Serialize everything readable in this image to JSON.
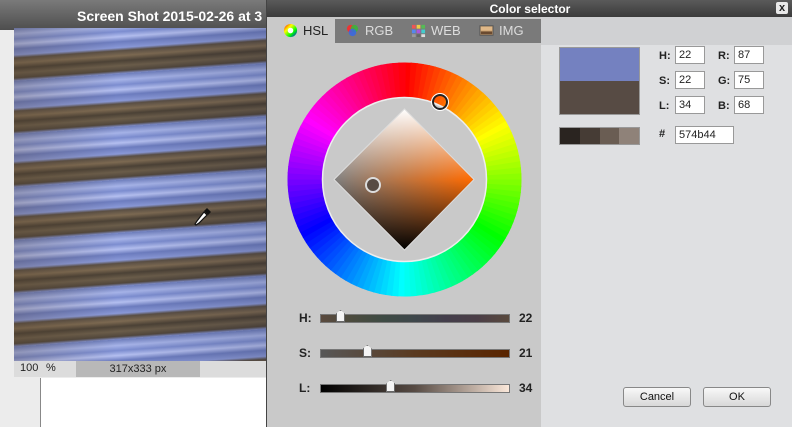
{
  "image_window": {
    "title": "Screen Shot 2015-02-26 at 3",
    "zoom": "100",
    "zoom_unit": "%",
    "dimensions": "317x333 px"
  },
  "dialog": {
    "title": "Color selector",
    "close": "x",
    "tabs": [
      {
        "label": "HSL",
        "icon": "color-wheel-icon",
        "active": true
      },
      {
        "label": "RGB",
        "icon": "rgb-circles-icon",
        "active": false
      },
      {
        "label": "WEB",
        "icon": "web-grid-icon",
        "active": false
      },
      {
        "label": "IMG",
        "icon": "image-icon",
        "active": false
      }
    ],
    "sliders": [
      {
        "label": "H:",
        "value": "22",
        "fraction": 0.061
      },
      {
        "label": "S:",
        "value": "21",
        "fraction": 0.21
      },
      {
        "label": "L:",
        "value": "34",
        "fraction": 0.34
      }
    ],
    "hsl_fields": {
      "h_label": "H:",
      "h": "22",
      "s_label": "S:",
      "s": "22",
      "l_label": "L:",
      "l": "34"
    },
    "rgb_fields": {
      "r_label": "R:",
      "r": "87",
      "g_label": "G:",
      "g": "75",
      "b_label": "B:",
      "b": "68"
    },
    "hex_label": "#",
    "hex": "574b44",
    "cancel_label": "Cancel",
    "ok_label": "OK",
    "colors": {
      "new_color": "#7481c0",
      "current_color": "#574b44",
      "swatches": [
        "#2a2420",
        "#463c35",
        "#6a5d53",
        "#8f8279"
      ]
    }
  }
}
